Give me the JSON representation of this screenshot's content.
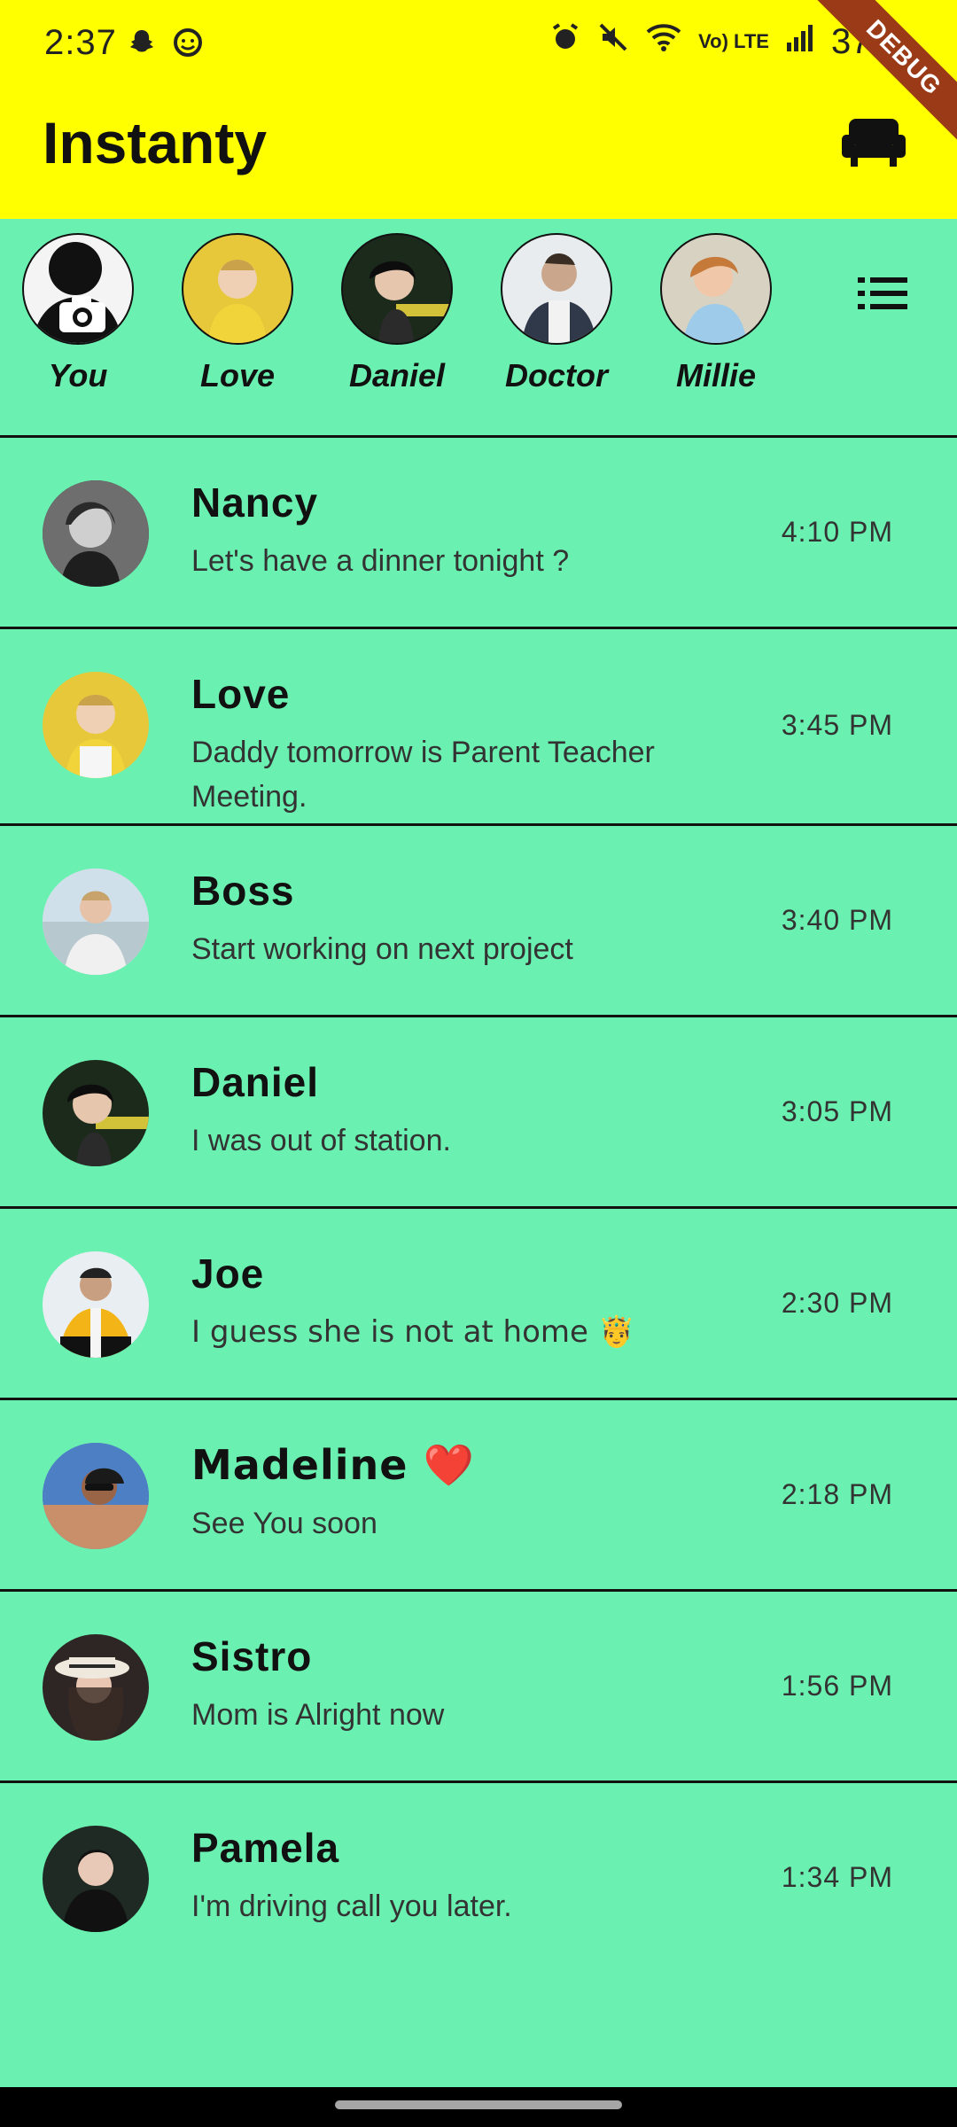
{
  "status_bar": {
    "time": "2:37",
    "left_icons": [
      "snapchat-icon",
      "face-icon"
    ],
    "right_icons": [
      "alarm-icon",
      "mute-icon",
      "wifi-icon",
      "volte-icon",
      "signal-icon"
    ],
    "volte_label": "Vo) LTE",
    "battery": "37%"
  },
  "app_bar": {
    "title": "Instanty",
    "action_icon": "sofa-icon",
    "debug_ribbon": "DEBUG"
  },
  "stories": [
    {
      "name": "You",
      "color": "#2b2b2b"
    },
    {
      "name": "Love",
      "color": "#e6c83a"
    },
    {
      "name": "Daniel",
      "color": "#2a3a2a"
    },
    {
      "name": "Doctor",
      "color": "#6d6e72"
    },
    {
      "name": "Millie",
      "color": "#c9a489"
    }
  ],
  "chats": [
    {
      "name": "Nancy",
      "message": "Let's have a dinner tonight ?",
      "time": "4:10 PM"
    },
    {
      "name": "Love",
      "message": "Daddy tomorrow is Parent Teacher Meeting.",
      "time": "3:45 PM"
    },
    {
      "name": "Boss",
      "message": "Start working on next project",
      "time": "3:40 PM"
    },
    {
      "name": "Daniel",
      "message": "I was out of station.",
      "time": "3:05 PM"
    },
    {
      "name": "Joe",
      "message": "I guess she is not at home 🤴",
      "time": "2:30 PM"
    },
    {
      "name": "Madeline ❤️",
      "message": "See You soon",
      "time": "2:18 PM"
    },
    {
      "name": "Sistro",
      "message": "Mom is Alright now",
      "time": "1:56 PM"
    },
    {
      "name": "Pamela",
      "message": "I'm driving call you later.",
      "time": "1:34 PM"
    }
  ],
  "colors": {
    "app_bar": "#ffff00",
    "background": "#6af0b0",
    "divider": "#111111"
  }
}
